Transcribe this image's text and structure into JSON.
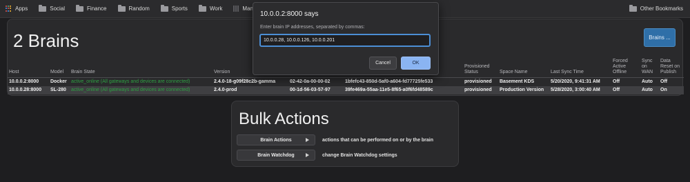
{
  "bookmarks": {
    "apps_label": "Apps",
    "folders": [
      "Social",
      "Finance",
      "Random",
      "Sports",
      "Work"
    ],
    "manager_label": "Manager",
    "other_label": "Other Bookmarks"
  },
  "brains_panel": {
    "title": "2 Brains",
    "menu_button": "Brains ...",
    "columns": [
      "Host",
      "Model",
      "Brain State",
      "Version",
      "",
      "",
      "Provisioned Status",
      "Space Name",
      "Last Sync Time",
      "Forced Active Offline",
      "Sync on WAN",
      "Data Reset on Publish"
    ],
    "rows": [
      {
        "host": "10.0.0.2:8000",
        "model": "Docker",
        "state": "active_online (All gateways and devices are connected)",
        "version": "2.4.0-18-g09f28c2b-gamma",
        "mac": "02-42-0a-00-00-02",
        "uuid": "1bfefc43-850d-5af0-a604-fd77725fe533",
        "provisioned": "provisioned",
        "space": "Basement KDS",
        "last_sync": "5/20/2020, 9:41:31 AM",
        "forced_offline": "Off",
        "sync_wan": "Auto",
        "data_reset": "Off"
      },
      {
        "host": "10.0.0.28:8000",
        "model": "SL-280",
        "state": "active_online (All gateways and devices are connected)",
        "version": "2.4.0-prod",
        "mac": "00-1d-56-03-57-97",
        "uuid": "39fe469a-55aa-11e5-8f65-a0f6fd48589c",
        "provisioned": "provisioned",
        "space": "Production Version",
        "last_sync": "5/28/2020, 3:00:40 AM",
        "forced_offline": "Off",
        "sync_wan": "Auto",
        "data_reset": "On"
      }
    ]
  },
  "bulk_actions": {
    "title": "Bulk Actions",
    "items": [
      {
        "label": "Brain Actions",
        "description": "actions that can be performed on or by the brain"
      },
      {
        "label": "Brain Watchdog",
        "description": "change Brain Watchdog settings"
      }
    ]
  },
  "dialog": {
    "title": "10.0.0.2:8000 says",
    "message": "Enter brain IP addresses, separated by commas:",
    "input_value": "10.0.0.28, 10.0.0.126, 10.0.0.201",
    "cancel_label": "Cancel",
    "ok_label": "OK"
  },
  "colors": {
    "background": "#1e1e20",
    "panel": "#2a2a2c",
    "accent_blue": "#2f6fa8",
    "ok_button": "#8ab4f2",
    "state_green": "#2ea043"
  }
}
